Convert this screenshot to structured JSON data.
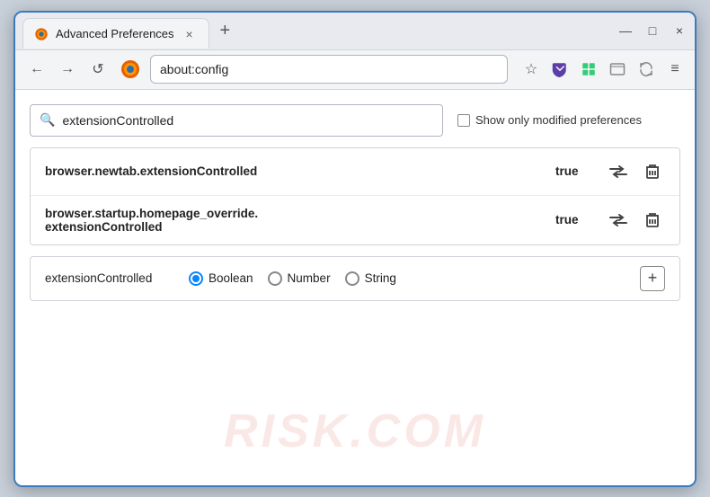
{
  "window": {
    "title": "Advanced Preferences",
    "tab_close": "×",
    "tab_new": "+",
    "win_minimize": "—",
    "win_maximize": "□",
    "win_close": "×"
  },
  "nav": {
    "back": "←",
    "forward": "→",
    "refresh": "↺",
    "firefox_label": "Firefox",
    "address": "about:config",
    "star": "☆",
    "shield": "⛉",
    "extension": "⊞",
    "profile": "✉",
    "sync": "↻",
    "menu": "≡"
  },
  "content": {
    "search_placeholder": "extensionControlled",
    "search_value": "extensionControlled",
    "show_modified_label": "Show only modified preferences",
    "watermark": "RISK.COM"
  },
  "prefs": [
    {
      "name": "browser.newtab.extensionControlled",
      "value": "true"
    },
    {
      "name": "browser.startup.homepage_override.\nextensionControlled",
      "name_line1": "browser.startup.homepage_override.",
      "name_line2": "extensionControlled",
      "value": "true"
    }
  ],
  "new_pref": {
    "name": "extensionControlled",
    "type_boolean": "Boolean",
    "type_number": "Number",
    "type_string": "String",
    "add_label": "+"
  },
  "icons": {
    "search": "🔍",
    "toggle": "⇌",
    "delete": "🗑",
    "radio_selected": "boolean",
    "add": "+"
  }
}
